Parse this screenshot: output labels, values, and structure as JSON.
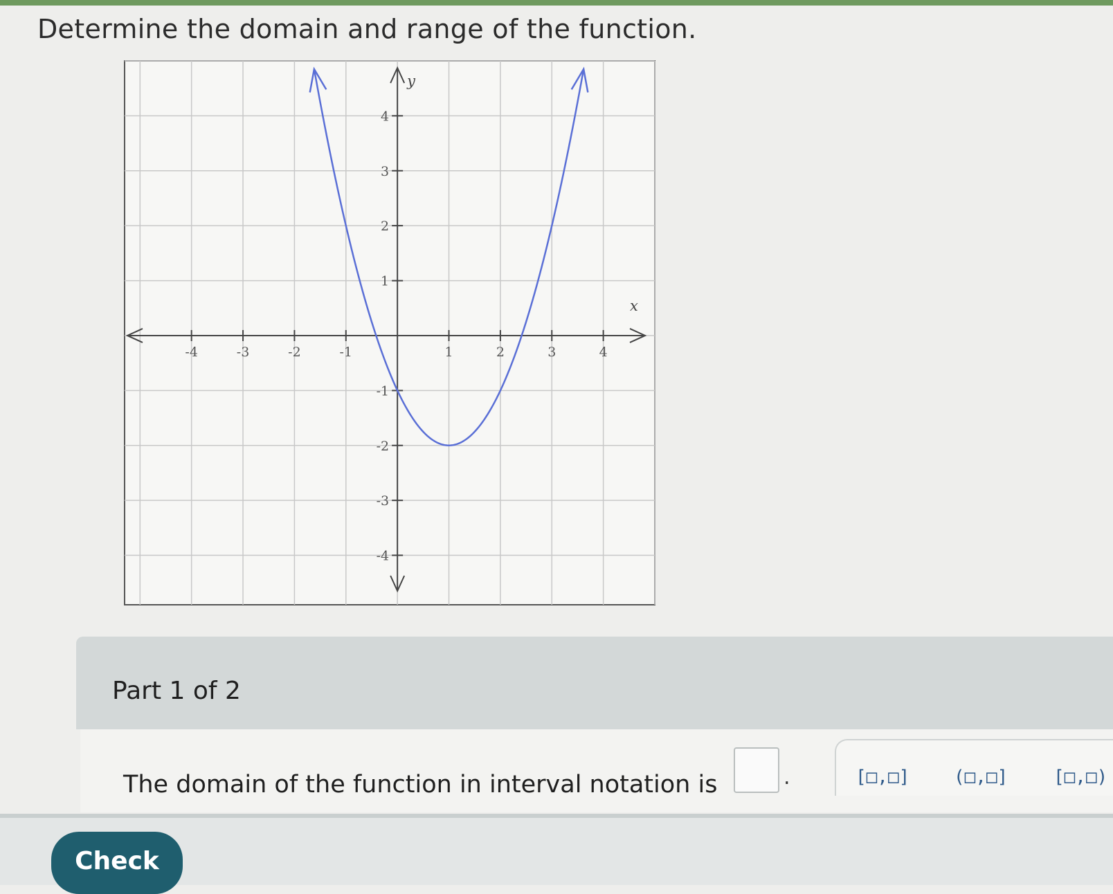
{
  "prompt": "Determine the domain and range of the function.",
  "chart_data": {
    "type": "line",
    "title": "",
    "xlabel": "x",
    "ylabel": "y",
    "xlim": [
      -5.3,
      5
    ],
    "ylim": [
      -4.9,
      5
    ],
    "x_ticks": [
      -4,
      -3,
      -2,
      -1,
      1,
      2,
      3,
      4
    ],
    "y_ticks": [
      -4,
      -3,
      -2,
      -1,
      1,
      2,
      3,
      4
    ],
    "x_tick_labels": [
      "-4",
      "-3",
      "-2",
      "-1",
      "1",
      "2",
      "3",
      "4"
    ],
    "y_tick_labels": [
      "-4",
      "-3",
      "-2",
      "-1",
      "1",
      "2",
      "3",
      "4"
    ],
    "grid": true,
    "series": [
      {
        "function": "y = (x - 1)^2 - 2",
        "vertex": [
          1,
          -2
        ],
        "x": [
          -1.8,
          -1.5,
          -1,
          -0.5,
          0,
          0.5,
          1,
          1.5,
          2,
          2.5,
          3,
          3.4
        ],
        "y": [
          5.84,
          4.25,
          2,
          0.25,
          -1,
          -1.75,
          -2,
          -1.75,
          -1,
          0.25,
          2,
          3.76
        ],
        "arrows_at_ends": true,
        "color": "#5a6fd6"
      }
    ]
  },
  "part": {
    "label": "Part 1 of 2"
  },
  "question": {
    "text": "The domain of the function in interval notation is",
    "answer_value": "",
    "trailing": "."
  },
  "palette": {
    "buttons": [
      "[□,□]",
      "(□,□]",
      "[□,□)"
    ]
  },
  "check_button": {
    "label": "Check"
  },
  "colors": {
    "curve": "#5a6fd6",
    "check_button": "#1f5e6e",
    "part_panel": "#d3d8d8"
  }
}
